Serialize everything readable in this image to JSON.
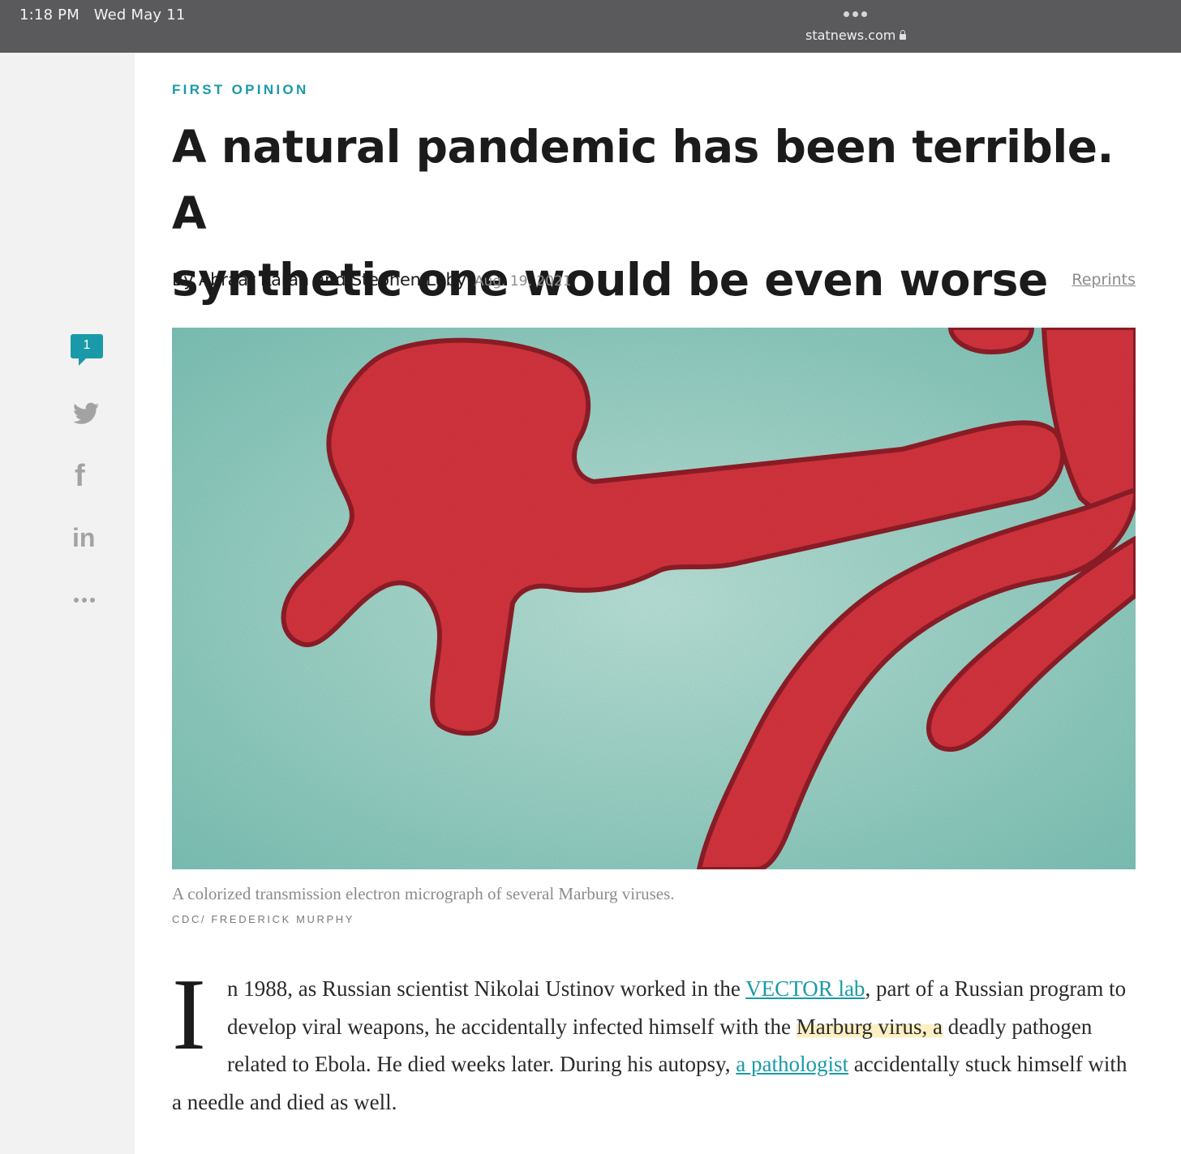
{
  "status_bar": {
    "time": "1:18 PM",
    "date": "Wed May 11",
    "url": "statnews.com"
  },
  "sidebar": {
    "comment_count": "1"
  },
  "article": {
    "kicker": "FIRST OPINION",
    "headline_line1": "A natural pandemic has been terrible. A",
    "headline_line2": "synthetic one would be even worse",
    "authors": "By Abraar Karan and Stephen Luby",
    "date": "Aug. 19, 2021",
    "reprints": "Reprints",
    "caption": "A colorized transmission electron micrograph of several Marburg viruses.",
    "credit": "CDC/ FREDERICK MURPHY",
    "dropcap": "I",
    "p_part1": "n 1988, as Russian scientist Nikolai Ustinov worked in the ",
    "link1": "VECTOR lab",
    "p_part2": ", part of a Russian program to develop viral weapons, he accidentally infected himself with the ",
    "highlight": "Marburg virus, a",
    "p_part3": " deadly pathogen related to Ebola. He died weeks later. During his autopsy, ",
    "link2": "a pathologist",
    "p_part4": " accidentally stuck himself with a needle and died as well."
  },
  "colors": {
    "accent": "#1a9aa8",
    "virus": "#d5343e",
    "background_teal": "#8fcdbf",
    "highlight": "#fcf0c3"
  }
}
